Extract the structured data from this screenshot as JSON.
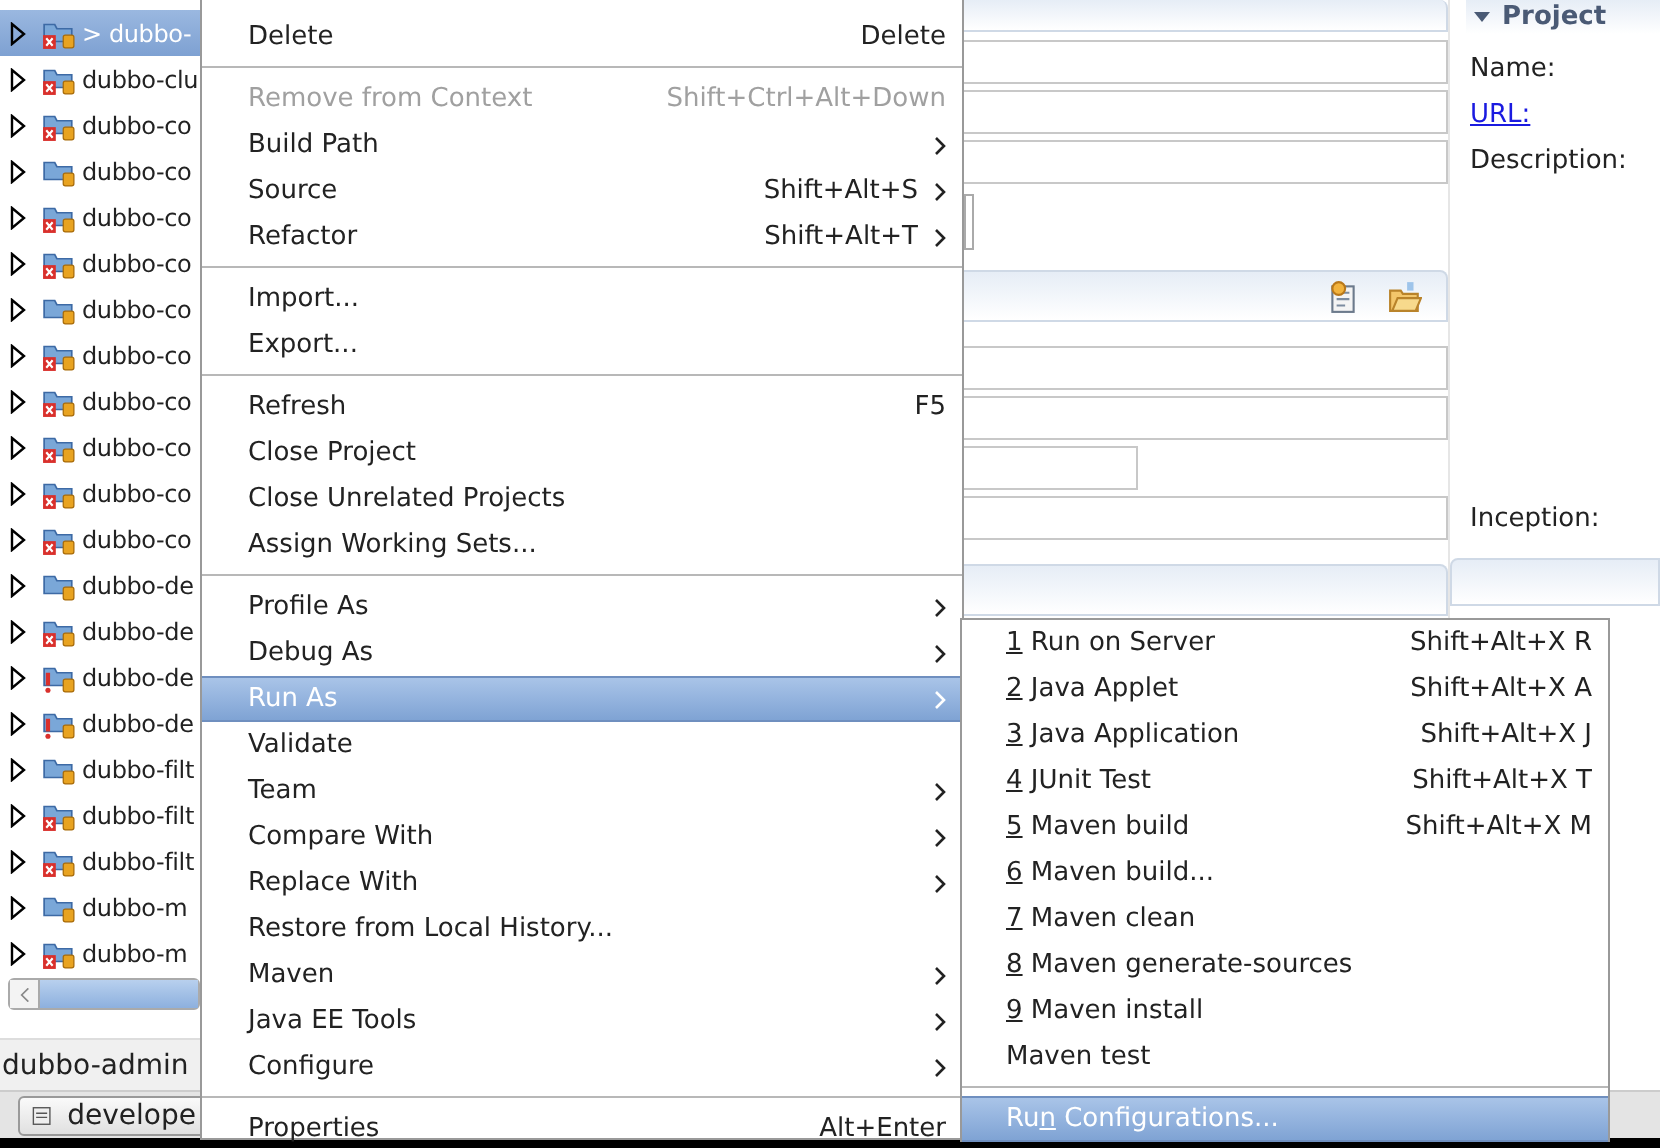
{
  "tree": {
    "rows": [
      {
        "label": "> dubbo-",
        "kind": "error",
        "selected": true
      },
      {
        "label": "dubbo-clu",
        "kind": "error",
        "selected": false
      },
      {
        "label": "dubbo-co",
        "kind": "error",
        "selected": false
      },
      {
        "label": "dubbo-co",
        "kind": "plain",
        "selected": false
      },
      {
        "label": "dubbo-co",
        "kind": "error",
        "selected": false
      },
      {
        "label": "dubbo-co",
        "kind": "error",
        "selected": false
      },
      {
        "label": "dubbo-co",
        "kind": "plain",
        "selected": false
      },
      {
        "label": "dubbo-co",
        "kind": "error",
        "selected": false
      },
      {
        "label": "dubbo-co",
        "kind": "error",
        "selected": false
      },
      {
        "label": "dubbo-co",
        "kind": "error",
        "selected": false
      },
      {
        "label": "dubbo-co",
        "kind": "error",
        "selected": false
      },
      {
        "label": "dubbo-co",
        "kind": "error",
        "selected": false
      },
      {
        "label": "dubbo-de",
        "kind": "plain",
        "selected": false
      },
      {
        "label": "dubbo-de",
        "kind": "error",
        "selected": false
      },
      {
        "label": "dubbo-de",
        "kind": "warning",
        "selected": false
      },
      {
        "label": "dubbo-de",
        "kind": "warning",
        "selected": false
      },
      {
        "label": "dubbo-filt",
        "kind": "plain",
        "selected": false
      },
      {
        "label": "dubbo-filt",
        "kind": "error",
        "selected": false
      },
      {
        "label": "dubbo-filt",
        "kind": "error",
        "selected": false
      },
      {
        "label": "dubbo-m",
        "kind": "plain",
        "selected": false
      },
      {
        "label": "dubbo-m",
        "kind": "error",
        "selected": false
      }
    ]
  },
  "status": {
    "label": "dubbo-admin"
  },
  "taskbar": {
    "button": "develope"
  },
  "project_panel": {
    "title": "Project",
    "fields": [
      {
        "label": "Name:",
        "kind": "text"
      },
      {
        "label": "URL:",
        "kind": "link"
      },
      {
        "label": "Description:",
        "kind": "text"
      }
    ],
    "inception": "Inception:"
  },
  "context_menu": {
    "items": [
      {
        "kind": "item",
        "label": "Delete",
        "shortcut": "Delete",
        "submenu": false,
        "disabled": false,
        "selected": false
      },
      {
        "kind": "separator"
      },
      {
        "kind": "item",
        "label": "Remove from Context",
        "shortcut": "Shift+Ctrl+Alt+Down",
        "submenu": false,
        "disabled": true,
        "selected": false
      },
      {
        "kind": "item",
        "label": "Build Path",
        "submenu": true,
        "disabled": false,
        "selected": false
      },
      {
        "kind": "item",
        "label": "Source",
        "shortcut": "Shift+Alt+S",
        "submenu": true,
        "disabled": false,
        "selected": false
      },
      {
        "kind": "item",
        "label": "Refactor",
        "shortcut": "Shift+Alt+T",
        "submenu": true,
        "disabled": false,
        "selected": false
      },
      {
        "kind": "separator"
      },
      {
        "kind": "item",
        "label": "Import...",
        "submenu": false,
        "disabled": false,
        "selected": false
      },
      {
        "kind": "item",
        "label": "Export...",
        "submenu": false,
        "disabled": false,
        "selected": false
      },
      {
        "kind": "separator"
      },
      {
        "kind": "item",
        "label": "Refresh",
        "shortcut": "F5",
        "submenu": false,
        "disabled": false,
        "selected": false
      },
      {
        "kind": "item",
        "label": "Close Project",
        "submenu": false,
        "disabled": false,
        "selected": false
      },
      {
        "kind": "item",
        "label": "Close Unrelated Projects",
        "submenu": false,
        "disabled": false,
        "selected": false
      },
      {
        "kind": "item",
        "label": "Assign Working Sets...",
        "submenu": false,
        "disabled": false,
        "selected": false
      },
      {
        "kind": "separator"
      },
      {
        "kind": "item",
        "label": "Profile As",
        "submenu": true,
        "disabled": false,
        "selected": false
      },
      {
        "kind": "item",
        "label": "Debug As",
        "submenu": true,
        "disabled": false,
        "selected": false
      },
      {
        "kind": "item",
        "label": "Run As",
        "submenu": true,
        "disabled": false,
        "selected": true
      },
      {
        "kind": "item",
        "label": "Validate",
        "submenu": false,
        "disabled": false,
        "selected": false
      },
      {
        "kind": "item",
        "label": "Team",
        "submenu": true,
        "disabled": false,
        "selected": false
      },
      {
        "kind": "item",
        "label": "Compare With",
        "submenu": true,
        "disabled": false,
        "selected": false
      },
      {
        "kind": "item",
        "label": "Replace With",
        "submenu": true,
        "disabled": false,
        "selected": false
      },
      {
        "kind": "item",
        "label": "Restore from Local History...",
        "submenu": false,
        "disabled": false,
        "selected": false
      },
      {
        "kind": "item",
        "label": "Maven",
        "submenu": true,
        "disabled": false,
        "selected": false
      },
      {
        "kind": "item",
        "label": "Java EE Tools",
        "submenu": true,
        "disabled": false,
        "selected": false
      },
      {
        "kind": "item",
        "label": "Configure",
        "submenu": true,
        "disabled": false,
        "selected": false
      },
      {
        "kind": "separator"
      },
      {
        "kind": "item",
        "label": "Properties",
        "shortcut": "Alt+Enter",
        "submenu": false,
        "disabled": false,
        "selected": false
      }
    ]
  },
  "run_as_menu": {
    "items": [
      {
        "kind": "item",
        "segments": [
          {
            "text": "1",
            "underlined": true
          },
          {
            "text": " Run on Server",
            "underlined": false
          }
        ],
        "shortcut": "Shift+Alt+X R",
        "selected": false
      },
      {
        "kind": "item",
        "segments": [
          {
            "text": "2",
            "underlined": true
          },
          {
            "text": " Java Applet",
            "underlined": false
          }
        ],
        "shortcut": "Shift+Alt+X A",
        "selected": false
      },
      {
        "kind": "item",
        "segments": [
          {
            "text": "3",
            "underlined": true
          },
          {
            "text": " Java Application",
            "underlined": false
          }
        ],
        "shortcut": "Shift+Alt+X J",
        "selected": false
      },
      {
        "kind": "item",
        "segments": [
          {
            "text": "4",
            "underlined": true
          },
          {
            "text": " JUnit Test",
            "underlined": false
          }
        ],
        "shortcut": "Shift+Alt+X T",
        "selected": false
      },
      {
        "kind": "item",
        "segments": [
          {
            "text": "5",
            "underlined": true
          },
          {
            "text": " Maven build",
            "underlined": false
          }
        ],
        "shortcut": "Shift+Alt+X M",
        "selected": false
      },
      {
        "kind": "item",
        "segments": [
          {
            "text": "6",
            "underlined": true
          },
          {
            "text": " Maven build...",
            "underlined": false
          }
        ],
        "selected": false
      },
      {
        "kind": "item",
        "segments": [
          {
            "text": "7",
            "underlined": true
          },
          {
            "text": " Maven clean",
            "underlined": false
          }
        ],
        "selected": false
      },
      {
        "kind": "item",
        "segments": [
          {
            "text": "8",
            "underlined": true
          },
          {
            "text": " Maven generate-sources",
            "underlined": false
          }
        ],
        "selected": false
      },
      {
        "kind": "item",
        "segments": [
          {
            "text": "9",
            "underlined": true
          },
          {
            "text": " Maven install",
            "underlined": false
          }
        ],
        "selected": false
      },
      {
        "kind": "item",
        "segments": [
          {
            "text": "Maven test",
            "underlined": false
          }
        ],
        "selected": false
      },
      {
        "kind": "separator"
      },
      {
        "kind": "item",
        "segments": [
          {
            "text": "Ru",
            "underlined": false
          },
          {
            "text": "n",
            "underlined": true
          },
          {
            "text": " Configurations...",
            "underlined": false
          }
        ],
        "selected": true
      }
    ]
  }
}
